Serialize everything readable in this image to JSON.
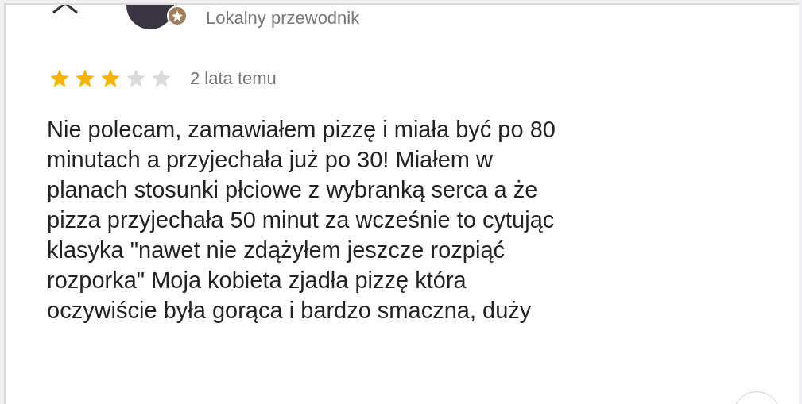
{
  "reviewer": {
    "badge": "Lokalny przewodnik"
  },
  "review": {
    "stars": 3,
    "time": "2 lata temu",
    "lines": [
      "Nie polecam, zamawiałem pizzę i miała być po 80",
      "minutach a przyjechała już po 30! Miałem w",
      "planach stosunki płciowe z wybranką serca a że",
      "pizza przyjechała 50 minut za wcześnie to cytując",
      "klasyka \"nawet nie zdążyłem jeszcze rozpiąć",
      "rozporka\" Moja kobieta zjadła pizzę która",
      "oczywiście była gorąca i bardzo smaczna, duży"
    ]
  }
}
